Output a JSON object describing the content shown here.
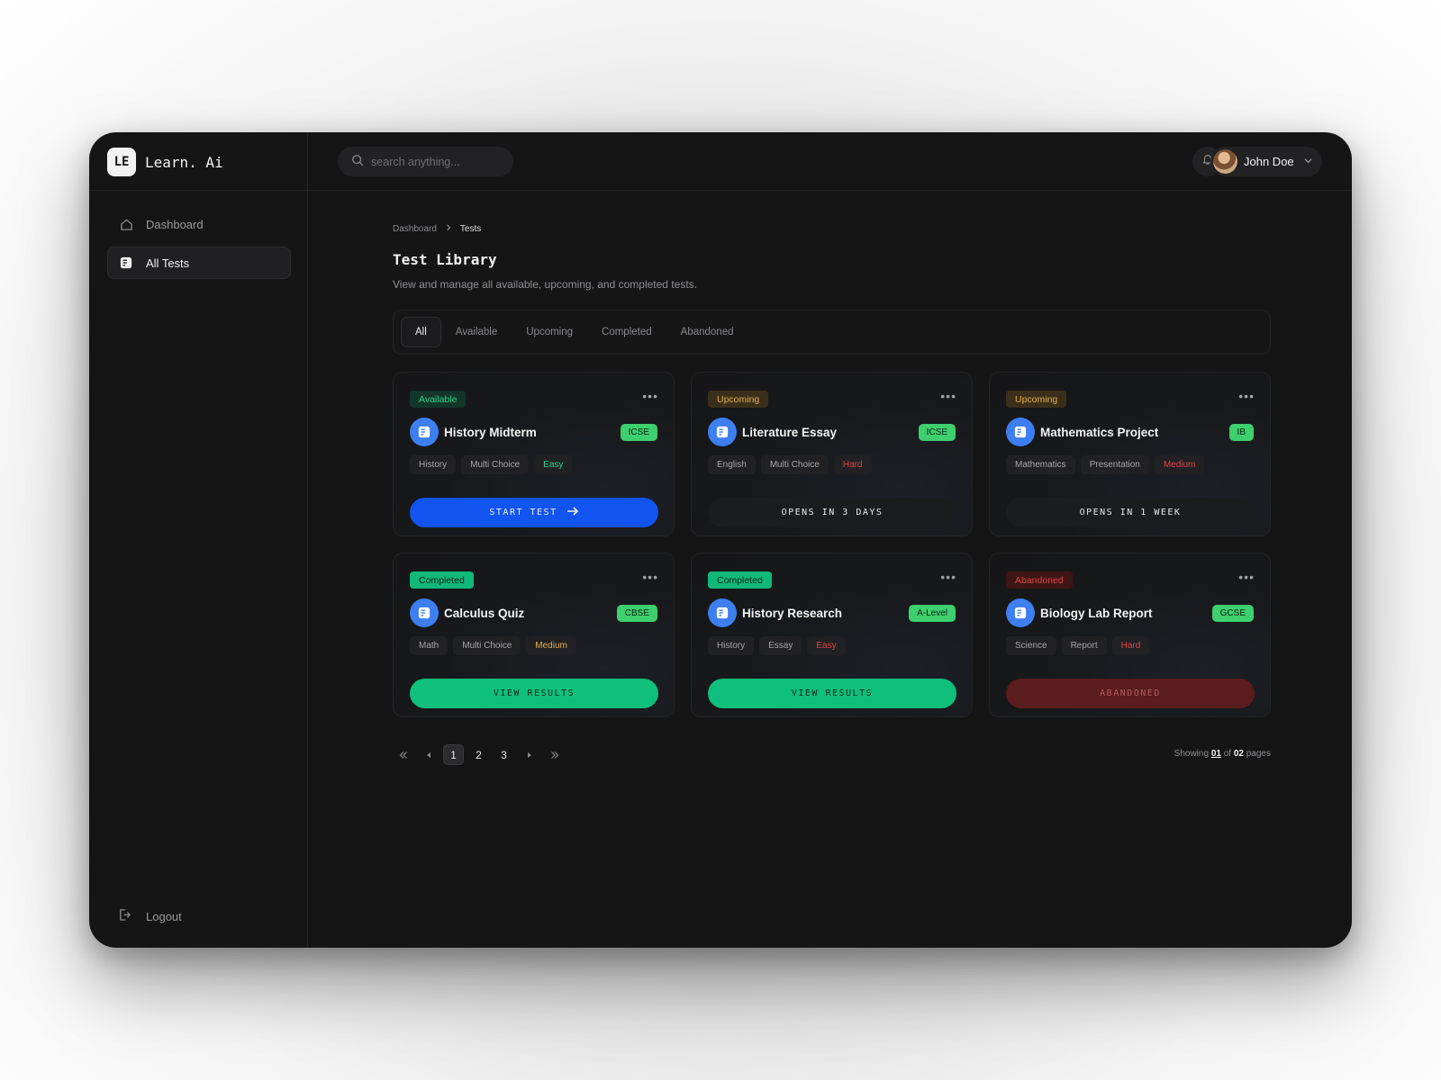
{
  "brand": {
    "logo": "LE",
    "name": "Learn. Ai"
  },
  "sidebar": {
    "items": [
      {
        "label": "Dashboard",
        "icon": "home-icon",
        "active": false
      },
      {
        "label": "All Tests",
        "icon": "tests-icon",
        "active": true
      }
    ],
    "logout": "Logout"
  },
  "topbar": {
    "search_placeholder": "search anything...",
    "user_name": "John Doe"
  },
  "breadcrumb": {
    "parent": "Dashboard",
    "current": "Tests"
  },
  "page": {
    "title": "Test Library",
    "subtitle": "View and manage all available, upcoming, and completed tests."
  },
  "tabs": [
    "All",
    "Available",
    "Upcoming",
    "Completed",
    "Abandoned"
  ],
  "active_tab": "All",
  "cards": [
    {
      "status": "Available",
      "name": "History Midterm",
      "board": "ICSE",
      "tags": [
        "History",
        "Multi Choice"
      ],
      "difficulty": "Easy",
      "action": "START TEST"
    },
    {
      "status": "Upcoming",
      "name": "Literature Essay",
      "board": "ICSE",
      "tags": [
        "English",
        "Multi Choice"
      ],
      "difficulty": "Hard",
      "action": "OPENS IN 3 DAYS"
    },
    {
      "status": "Upcoming",
      "name": "Mathematics Project",
      "board": "IB",
      "tags": [
        "Mathematics",
        "Presentation"
      ],
      "difficulty": "Medium",
      "action": "OPENS IN 1 WEEK"
    },
    {
      "status": "Completed",
      "name": "Calculus Quiz",
      "board": "CBSE",
      "tags": [
        "Math",
        "Multi Choice"
      ],
      "difficulty": "Medium",
      "action": "VIEW RESULTS"
    },
    {
      "status": "Completed",
      "name": "History Research",
      "board": "A-Level",
      "tags": [
        "History",
        "Essay"
      ],
      "difficulty": "Easy",
      "action": "VIEW RESULTS"
    },
    {
      "status": "Abandoned",
      "name": "Biology Lab Report",
      "board": "GCSE",
      "tags": [
        "Science",
        "Report"
      ],
      "difficulty": "Hard",
      "action": "ABANDONED"
    }
  ],
  "pagination": {
    "pages": [
      "1",
      "2",
      "3"
    ],
    "current": "1",
    "showing_prefix": "Showing",
    "showing_current": "01",
    "showing_of": "of",
    "showing_total": "02",
    "showing_suffix": "pages"
  },
  "colors": {
    "app_bg": "#151516",
    "start_button": "#1254f0",
    "results_button": "#0fbf7c",
    "abandoned_button": "#5a1c1c",
    "board_badge": "#3ecf6e",
    "icon_bg": "#3d7ef0"
  }
}
